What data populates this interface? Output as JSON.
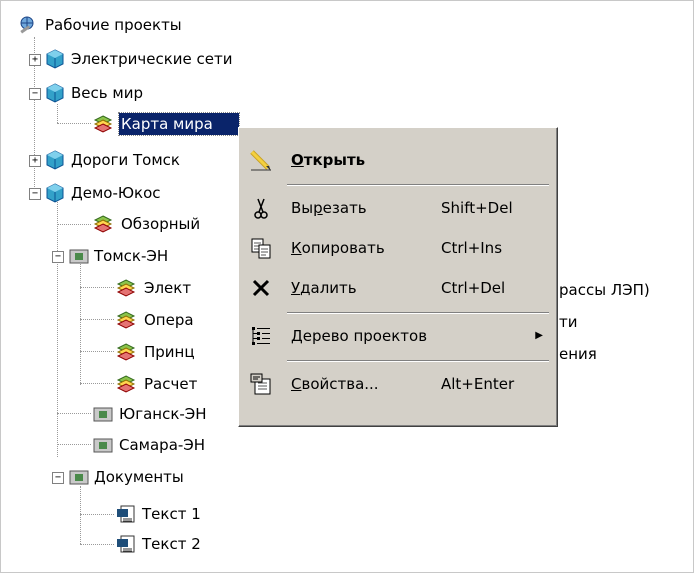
{
  "tree": {
    "root": {
      "label": "Рабочие проекты",
      "icon": "globe-tools-icon"
    },
    "nodes": [
      {
        "label": "Электрические сети",
        "icon": "project-cube-icon"
      },
      {
        "label": "Весь мир",
        "icon": "project-cube-icon"
      },
      {
        "label": "Карта мира",
        "icon": "map-layers-icon"
      },
      {
        "label": "Дороги Томск",
        "icon": "project-cube-icon"
      },
      {
        "label": "Демо-Юкос",
        "icon": "project-cube-icon"
      },
      {
        "label": "Обзорный",
        "icon": "map-layers-icon"
      },
      {
        "label": "Томск-ЭН",
        "icon": "folder-icon"
      },
      {
        "label": "Элект",
        "icon": "map-layers-icon"
      },
      {
        "label": "Опера",
        "icon": "map-layers-icon"
      },
      {
        "label": "Принц",
        "icon": "map-layers-icon"
      },
      {
        "label": "Расчет",
        "icon": "map-layers-icon"
      },
      {
        "label": "Юганск-ЭН",
        "icon": "folder-icon"
      },
      {
        "label": "Самара-ЭН",
        "icon": "folder-icon"
      },
      {
        "label": "Документы",
        "icon": "folder-icon"
      },
      {
        "label": "Текст 1",
        "icon": "text-document-icon"
      },
      {
        "label": "Текст 2",
        "icon": "text-document-icon"
      }
    ],
    "overflow_text": {
      "line1": "рассы ЛЭП)",
      "line2": "ти",
      "line3": "ения"
    }
  },
  "context_menu": {
    "open": {
      "label": "Открыть",
      "mnemonic": "О",
      "rest": "ткрыть",
      "icon": "pencil-icon"
    },
    "cut": {
      "pre": "Вы",
      "mnemonic": "р",
      "rest": "езать",
      "shortcut": "Shift+Del",
      "icon": "scissors-icon"
    },
    "copy": {
      "mnemonic": "К",
      "rest": "опировать",
      "shortcut": "Ctrl+Ins",
      "icon": "copy-icon"
    },
    "delete": {
      "mnemonic": "У",
      "rest": "далить",
      "shortcut": "Ctrl+Del",
      "icon": "delete-x-icon"
    },
    "tree": {
      "mnemonic": "Д",
      "rest": "ерево проектов",
      "icon": "tree-list-icon"
    },
    "props": {
      "mnemonic": "С",
      "rest": "войства...",
      "shortcut": "Alt+Enter",
      "icon": "properties-icon"
    }
  },
  "colors": {
    "selection": "#0a246a",
    "menu_bg": "#d4d0c8"
  }
}
